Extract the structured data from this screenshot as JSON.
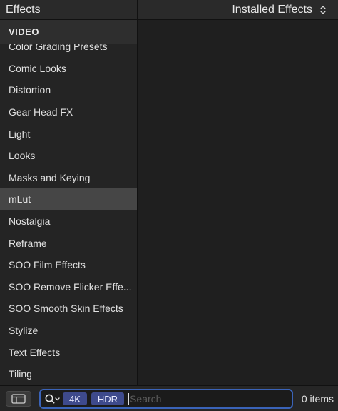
{
  "header": {
    "title": "Effects",
    "filter_label": "Installed Effects"
  },
  "sidebar": {
    "section_title": "VIDEO",
    "items": [
      {
        "label": "Color Grading Presets"
      },
      {
        "label": "Comic Looks"
      },
      {
        "label": "Distortion"
      },
      {
        "label": "Gear Head FX"
      },
      {
        "label": "Light"
      },
      {
        "label": "Looks"
      },
      {
        "label": "Masks and Keying"
      },
      {
        "label": "mLut"
      },
      {
        "label": "Nostalgia"
      },
      {
        "label": "Reframe"
      },
      {
        "label": "SOO Film Effects"
      },
      {
        "label": "SOO Remove Flicker Effe..."
      },
      {
        "label": "SOO Smooth Skin Effects"
      },
      {
        "label": "Stylize"
      },
      {
        "label": "Text Effects"
      },
      {
        "label": "Tiling"
      }
    ],
    "selected_index": 7
  },
  "footer": {
    "tags": [
      "4K",
      "HDR"
    ],
    "search_value": "",
    "search_placeholder": "Search",
    "count": "0 items"
  },
  "colors": {
    "selection": "#464646",
    "search_focus": "#3a63b8",
    "tag_bg": "#3e4a8c"
  },
  "icons": {
    "view_toggle": "sidebar-toggle-icon",
    "search": "magnifier-icon",
    "filter_popup": "up-down-chevron-icon"
  }
}
